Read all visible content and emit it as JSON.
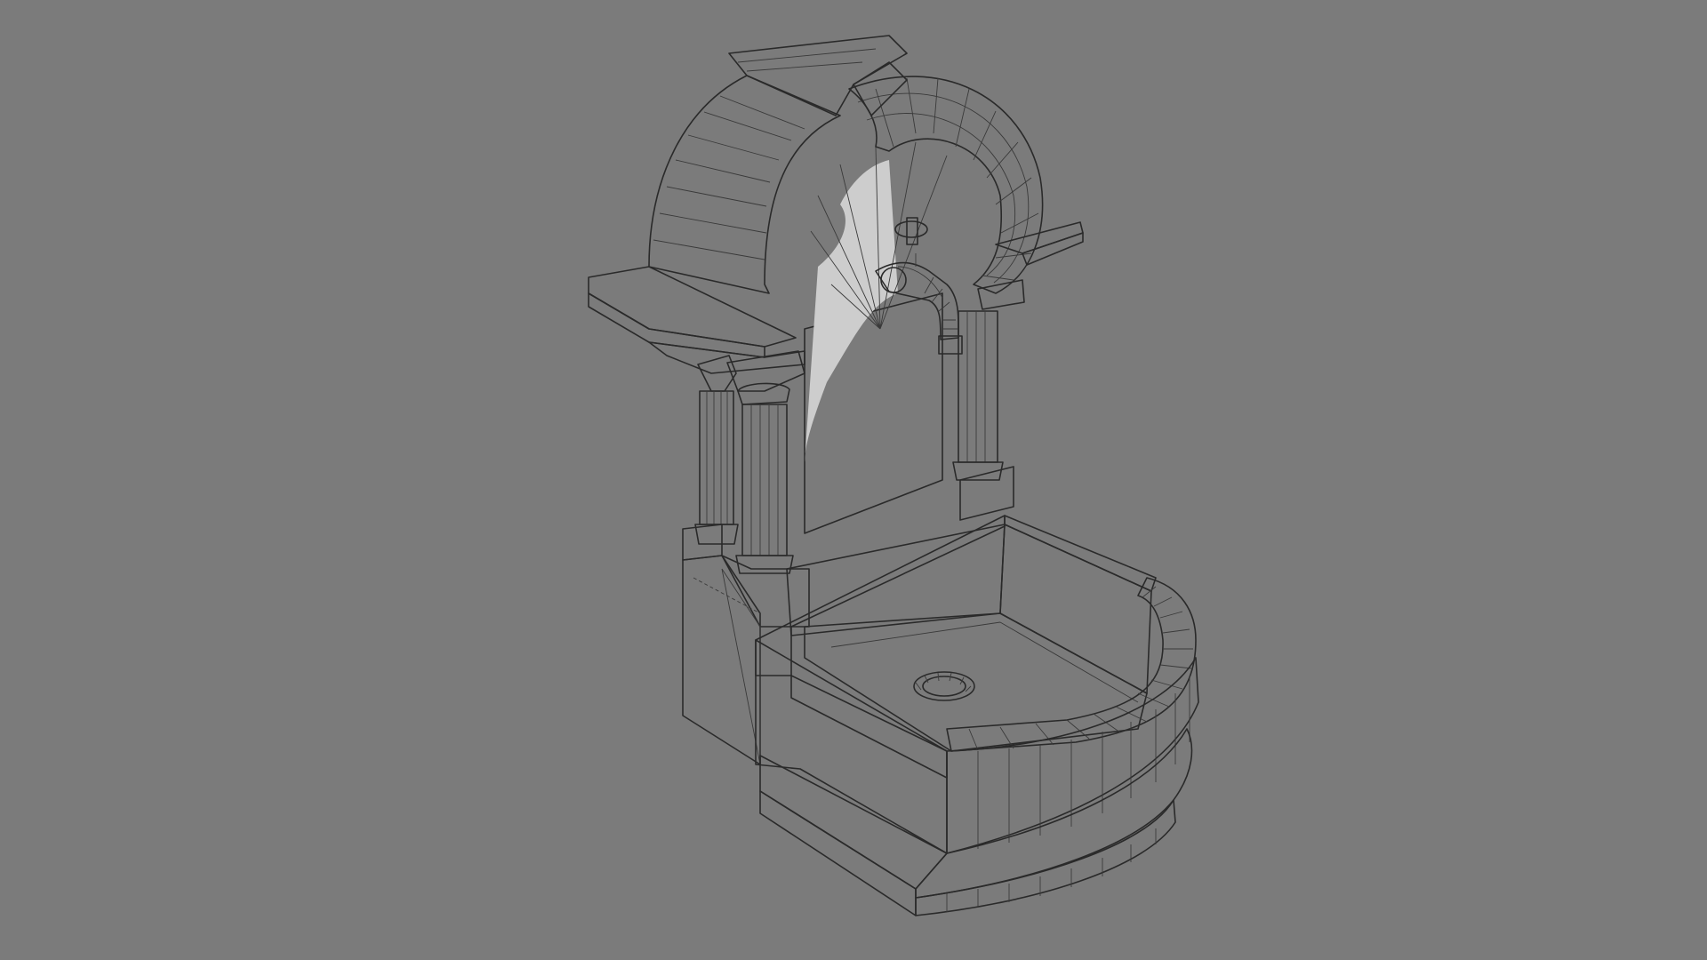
{
  "viewport": {
    "background_color": "#7b7b7b",
    "model_fill_light": "#e6e6e6",
    "model_fill_mid": "#cfcfcf",
    "model_fill_dark": "#b9b9b9",
    "wire_color": "#2a2a2a",
    "shadow_color": "#c4c4c4"
  },
  "model": {
    "subject": "stone-wall-fountain",
    "parts": [
      "arch",
      "keystone",
      "cornice-left",
      "cornice-right",
      "back-panel",
      "faucet",
      "column-left-rear",
      "column-left-front",
      "column-right",
      "pedestal-left",
      "basin",
      "drain",
      "base-plinth"
    ]
  }
}
